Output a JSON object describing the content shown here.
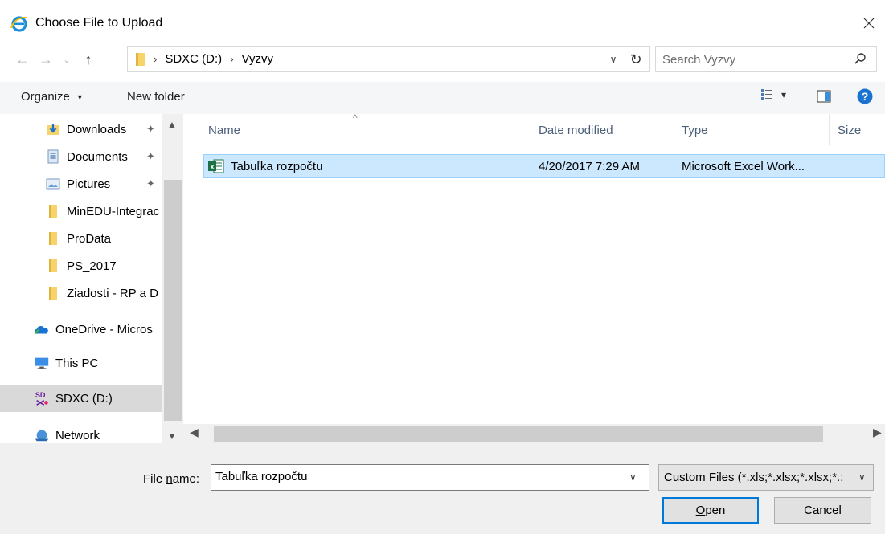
{
  "window": {
    "title": "Choose File to Upload",
    "icon": "internet-explorer-icon",
    "close": "×"
  },
  "nav_buttons": {
    "back": "←",
    "forward": "→",
    "recent": "⌄",
    "up": "↑"
  },
  "address": {
    "crumbs": [
      "SDXC (D:)",
      "Vyzvy"
    ],
    "separator": "›",
    "dropdown": "∨",
    "refresh": "↻"
  },
  "search": {
    "placeholder": "Search Vyzvy"
  },
  "toolbar": {
    "organize": "Organize",
    "organize_caret": "▼",
    "new_folder": "New folder",
    "views_caret": "▾"
  },
  "nav": {
    "items": [
      {
        "label": "Downloads",
        "icon": "downloads-icon",
        "pinned": true
      },
      {
        "label": "Documents",
        "icon": "documents-icon",
        "pinned": true
      },
      {
        "label": "Pictures",
        "icon": "pictures-icon",
        "pinned": true
      },
      {
        "label": "MinEDU-Integrac",
        "icon": "folder-icon"
      },
      {
        "label": "ProData",
        "icon": "folder-icon"
      },
      {
        "label": "PS_2017",
        "icon": "folder-icon"
      },
      {
        "label": "Ziadosti - RP a D",
        "icon": "folder-icon"
      },
      {
        "label": "OneDrive - Micros",
        "icon": "onedrive-icon"
      },
      {
        "label": "This PC",
        "icon": "this-pc-icon"
      },
      {
        "label": "SDXC (D:)",
        "icon": "sdxc-drive-icon",
        "selected": true
      },
      {
        "label": "Network",
        "icon": "network-icon"
      }
    ],
    "pin_glyph": "📌"
  },
  "columns": {
    "name": "Name",
    "date_modified": "Date modified",
    "type": "Type",
    "size": "Size",
    "sort_caret": "^"
  },
  "files": [
    {
      "name": "Tabuľka rozpočtu",
      "date_modified": "4/20/2017 7:29 AM",
      "type": "Microsoft Excel Work...",
      "icon": "excel-file-icon",
      "selected": true
    }
  ],
  "bottom": {
    "file_name_label_pre": "File ",
    "file_name_label_accel": "n",
    "file_name_label_post": "ame:",
    "file_name_value": "Tabuľka rozpočtu",
    "file_type": "Custom Files (*.xls;*.xlsx;*.xlsx;*.:",
    "open_accel": "O",
    "open_rest": "pen",
    "cancel": "Cancel"
  },
  "colors": {
    "selection_bg": "#cce8ff",
    "selection_border": "#99d1ff",
    "nav_selected": "#d9d9d9",
    "accent": "#0078d7"
  }
}
